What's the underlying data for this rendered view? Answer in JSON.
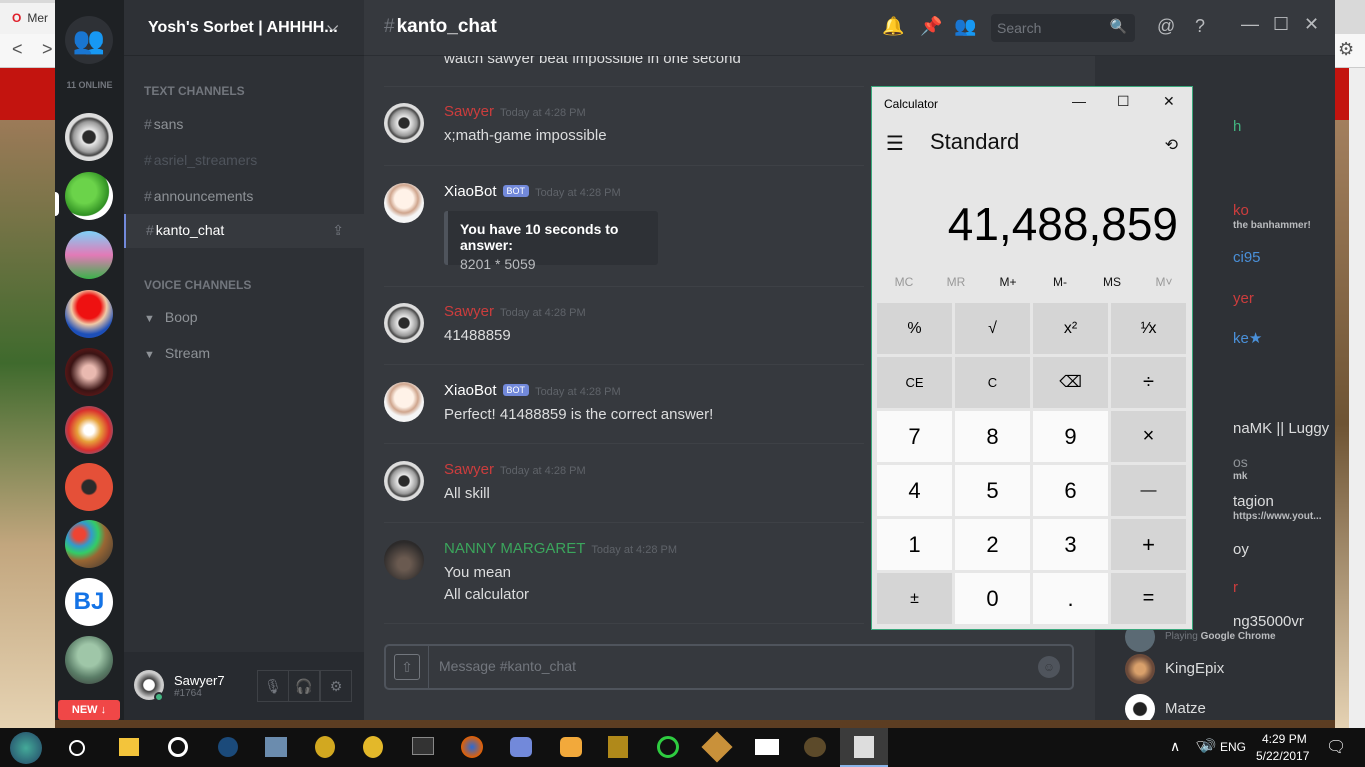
{
  "browser": {
    "tab_label": "Mer"
  },
  "discord": {
    "online_count": "11 ONLINE",
    "new_badge": "NEW ↓",
    "server_name": "Yosh's Sorbet | AHHHH...",
    "text_channels_label": "TEXT CHANNELS",
    "voice_channels_label": "VOICE CHANNELS",
    "channels": [
      "sans",
      "asriel_streamers",
      "announcements",
      "kanto_chat"
    ],
    "voice_channels": [
      "Boop",
      "Stream"
    ],
    "user": {
      "name": "Sawyer7",
      "tag": "#1764"
    },
    "chat": {
      "title": "kanto_chat",
      "search_placeholder": "Search",
      "composer_placeholder": "Message #kanto_chat",
      "top_partial": "watch sawyer beat impossible in one second",
      "messages": [
        {
          "author": "Sawyer",
          "time": "Today at 4:28 PM",
          "lines": [
            "x;math-game impossible"
          ]
        },
        {
          "author": "XiaoBot",
          "bot": "BOT",
          "time": "Today at 4:28 PM",
          "embed_title": "You have 10 seconds to answer:",
          "embed_desc": "8201 * 5059"
        },
        {
          "author": "Sawyer",
          "time": "Today at 4:28 PM",
          "lines": [
            "41488859"
          ]
        },
        {
          "author": "XiaoBot",
          "bot": "BOT",
          "time": "Today at 4:28 PM",
          "lines": [
            "Perfect! 41488859 is the correct answer!"
          ]
        },
        {
          "author": "Sawyer",
          "time": "Today at 4:28 PM",
          "lines": [
            "All skill"
          ]
        },
        {
          "author": "NANNY MARGARET",
          "time": "Today at 4:28 PM",
          "lines": [
            "You mean",
            "All calculator"
          ]
        }
      ]
    },
    "members": [
      {
        "name": "h",
        "color": "#43b581"
      },
      {
        "name": "ko",
        "color": "#cc3d3d"
      },
      {
        "name": "the banhammer!",
        "sub": true
      },
      {
        "name": "ci95",
        "color": "#4a90d9"
      },
      {
        "name": "yer",
        "color": "#cc3d3d"
      },
      {
        "name": "ke★",
        "color": "#4a90d9"
      },
      {
        "name": "naMK || Luggy",
        "color": "#dcddde"
      },
      {
        "name": "os",
        "color": "#8e9297"
      },
      {
        "name": "mk",
        "sub": true
      },
      {
        "name": "tagion",
        "color": "#dcddde"
      },
      {
        "name": "https://www.yout...",
        "sub": true
      },
      {
        "name": "oy",
        "color": "#dcddde"
      },
      {
        "name": "r",
        "color": "#cc3d3d"
      },
      {
        "name": "ng35000vr",
        "color": "#dcddde"
      },
      {
        "name": "Google Chrome",
        "prefix": "Playing",
        "sub": true
      },
      {
        "name": "KingEpix",
        "color": "#dcddde"
      },
      {
        "name": "Matze",
        "color": "#dcddde"
      }
    ]
  },
  "calculator": {
    "title": "Calculator",
    "mode": "Standard",
    "display": "41,488,859",
    "memory": [
      "MC",
      "MR",
      "M+",
      "M-",
      "MS",
      "M˅"
    ],
    "keys": [
      "%",
      "√",
      "x²",
      "¹⁄x",
      "CE",
      "C",
      "⌫",
      "÷",
      "7",
      "8",
      "9",
      "×",
      "4",
      "5",
      "6",
      "—",
      "1",
      "2",
      "3",
      "+",
      "±",
      "0",
      ".",
      "="
    ]
  },
  "taskbar": {
    "lang": "ENG",
    "time": "4:29 PM",
    "date": "5/22/2017"
  }
}
